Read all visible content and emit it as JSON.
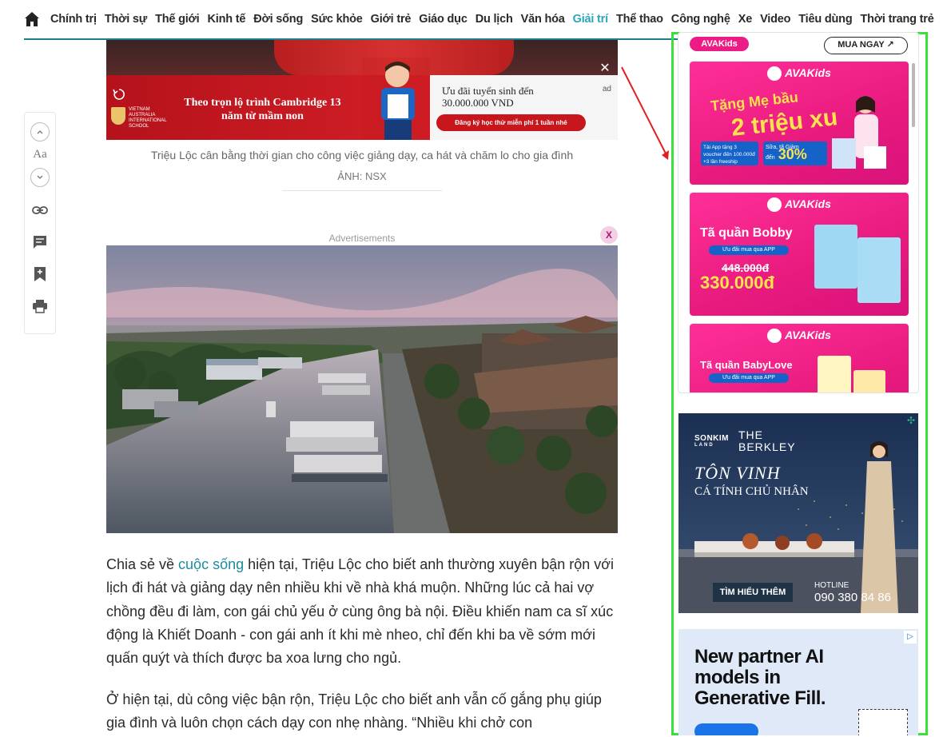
{
  "nav": {
    "items": [
      {
        "label": "Chính trị"
      },
      {
        "label": "Thời sự"
      },
      {
        "label": "Thế giới"
      },
      {
        "label": "Kinh tế"
      },
      {
        "label": "Đời sống"
      },
      {
        "label": "Sức khỏe"
      },
      {
        "label": "Giới trẻ"
      },
      {
        "label": "Giáo dục"
      },
      {
        "label": "Du lịch"
      },
      {
        "label": "Văn hóa"
      },
      {
        "label": "Giải trí",
        "active": true
      },
      {
        "label": "Thể thao"
      },
      {
        "label": "Công nghệ"
      },
      {
        "label": "Xe"
      },
      {
        "label": "Video"
      },
      {
        "label": "Tiêu dùng"
      },
      {
        "label": "Thời trang trẻ"
      }
    ],
    "accent_color": "#2aa6b8"
  },
  "toolbar": {
    "font_label": "Aa",
    "icons": [
      "chevron-up-icon",
      "chevron-down-icon",
      "link-icon",
      "comment-icon",
      "bookmark-add-icon",
      "print-icon"
    ]
  },
  "hero_ad": {
    "title": "Theo trọn lộ trình Cambridge 13 năm từ mầm non",
    "school_logo": "VIETNAM AUSTRALIA INTERNATIONAL SCHOOL",
    "offer_line1": "Ưu đãi tuyển sinh đến",
    "offer_line2": "30.000.000 VND",
    "cta": "Đăng ký học thử miễn phí 1 tuần nhé",
    "ad_tag": "ad"
  },
  "article": {
    "caption": "Triệu Lộc cân bằng thời gian cho công việc giảng dạy, ca hát và chăm lo cho gia đình",
    "credit": "ẢNH: NSX",
    "ads_label": "Advertisements",
    "ads_close": "X",
    "p1_before": "Chia sẻ về ",
    "p1_link": "cuộc sống",
    "p1_after": " hiện tại, Triệu Lộc cho biết anh thường xuyên bận rộn với lịch đi hát và giảng dạy nên nhiều khi về nhà khá muộn. Những lúc cả hai vợ chồng đều đi làm, con gái chủ yếu ở cùng ông bà nội. Điều khiến nam ca sĩ xúc động là Khiết Doanh - con gái anh ít khi mè nheo, chỉ đến khi ba về sớm mới quấn quýt và thích được ba xoa lưng cho ngủ.",
    "p2": "Ở hiện tại, dù công việc bận rộn, Triệu Lộc cho biết anh vẫn cố gắng phụ giúp gia đình và luôn chọn cách dạy con nhẹ nhàng. “Nhiều khi chở con"
  },
  "sidebar": {
    "ava": {
      "logo": "AVAKids",
      "buy_now": "MUA NGAY ↗",
      "card1": {
        "brand": "AVAKids",
        "line1": "Tặng Mẹ bầu",
        "line2": "2 triệu xu",
        "pill1": "Tải App tặng 3 voucher đến 100.000đ +3 lần freeship",
        "pill2_label": "Sữa, tã Giảm đến",
        "pill2_value": "30%"
      },
      "card2": {
        "brand": "AVAKids",
        "title": "Tã quần Bobby",
        "sub": "Ưu đãi mua qua APP",
        "old_price": "448.000đ",
        "new_price": "330.000đ"
      },
      "card3": {
        "brand": "AVAKids",
        "title": "Tã quần BabyLove",
        "sub": "Ưu đãi mua qua APP"
      }
    },
    "berkley": {
      "brand1": "SONKIM",
      "brand1_sub": "LAND",
      "brand2_l1": "THE",
      "brand2_l2": "BERKLEY",
      "headline1": "TÔN VINH",
      "headline2": "CÁ TÍNH CHỦ NHÂN",
      "cta": "TÌM HIỂU THÊM",
      "hotline_label": "HOTLINE",
      "hotline": "090 380 84 86"
    },
    "gen_ad": {
      "headline": "New partner AI models in Generative Fill."
    },
    "highlight_color": "#3be03b"
  }
}
